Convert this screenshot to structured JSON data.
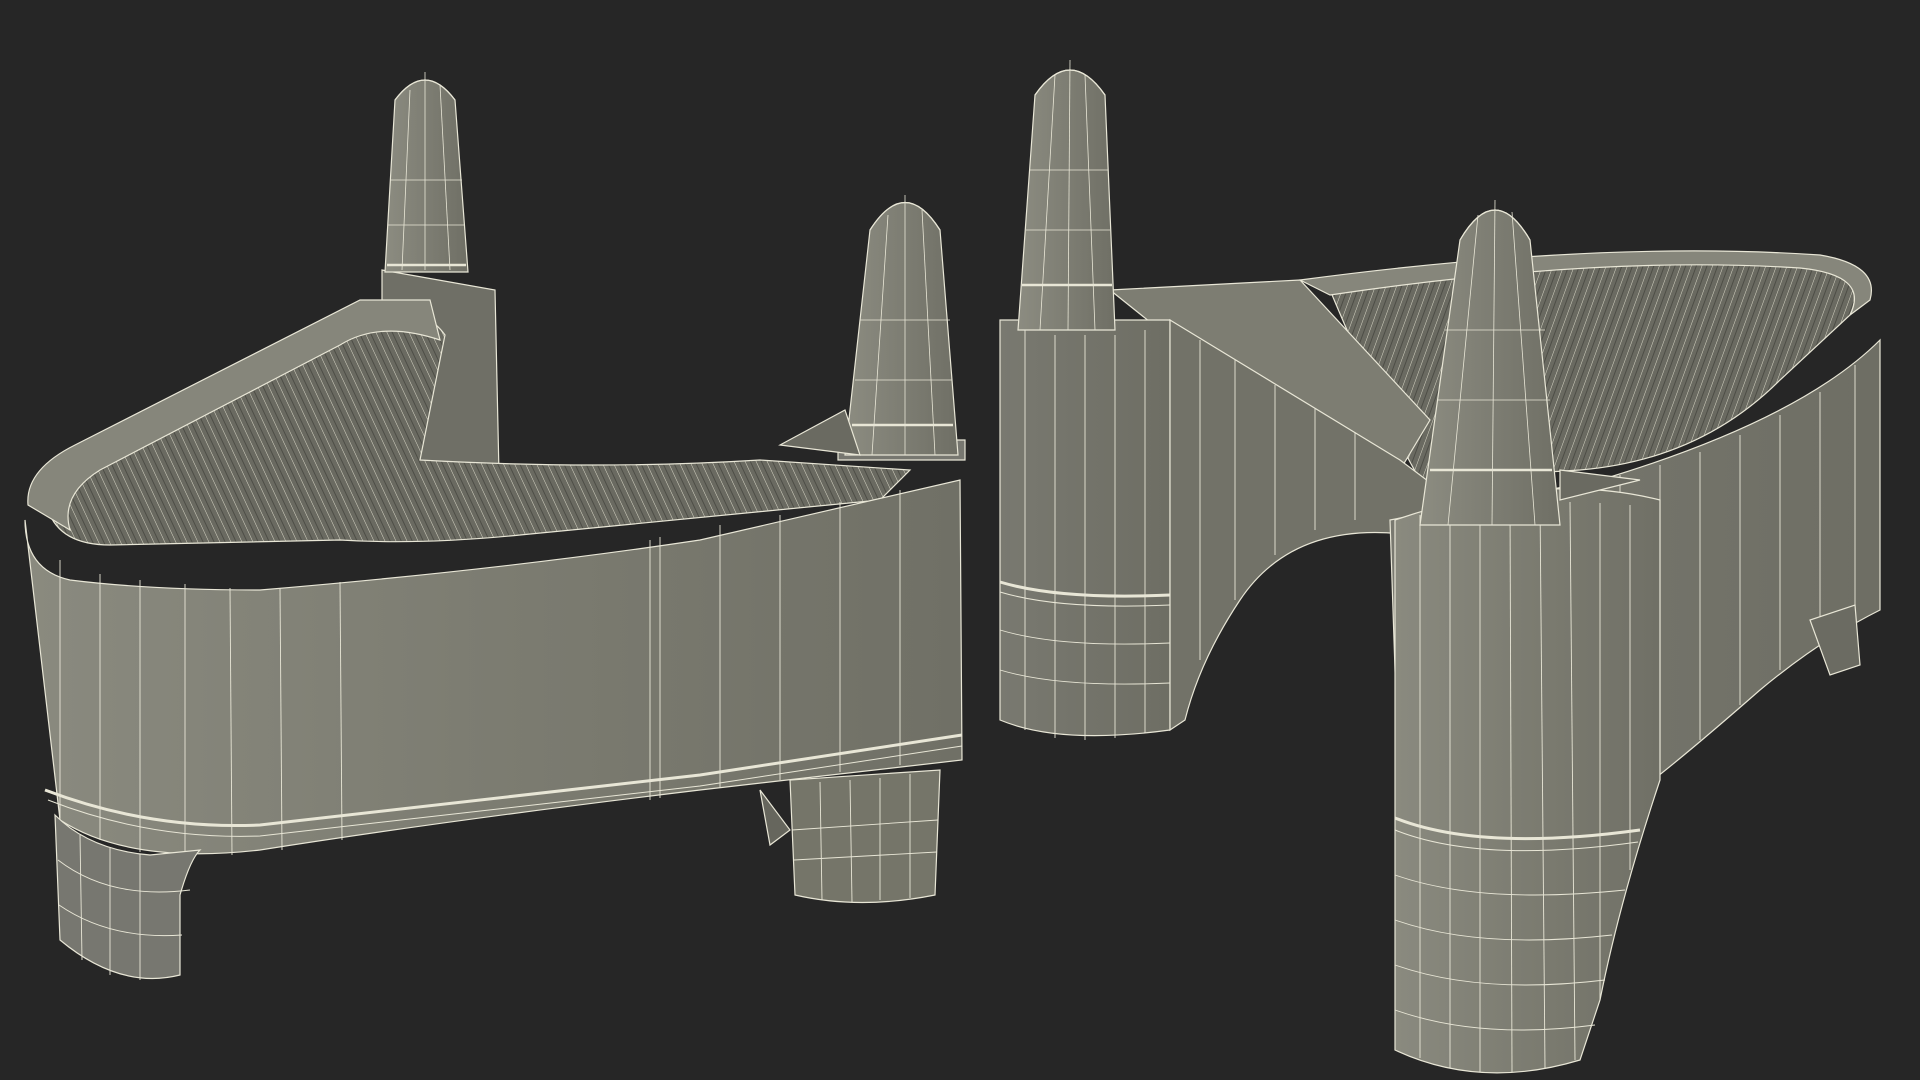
{
  "scene": {
    "background_color": "#262626",
    "mesh_fill_color": "#7b7b70",
    "mesh_shade_color": "#6a6a60",
    "mesh_dark_color": "#5d5d54",
    "wireframe_color": "#e8e6d6",
    "objects": [
      {
        "name": "clip-left",
        "view": "front-three-quarter"
      },
      {
        "name": "clip-right",
        "view": "rear-three-quarter"
      }
    ]
  }
}
